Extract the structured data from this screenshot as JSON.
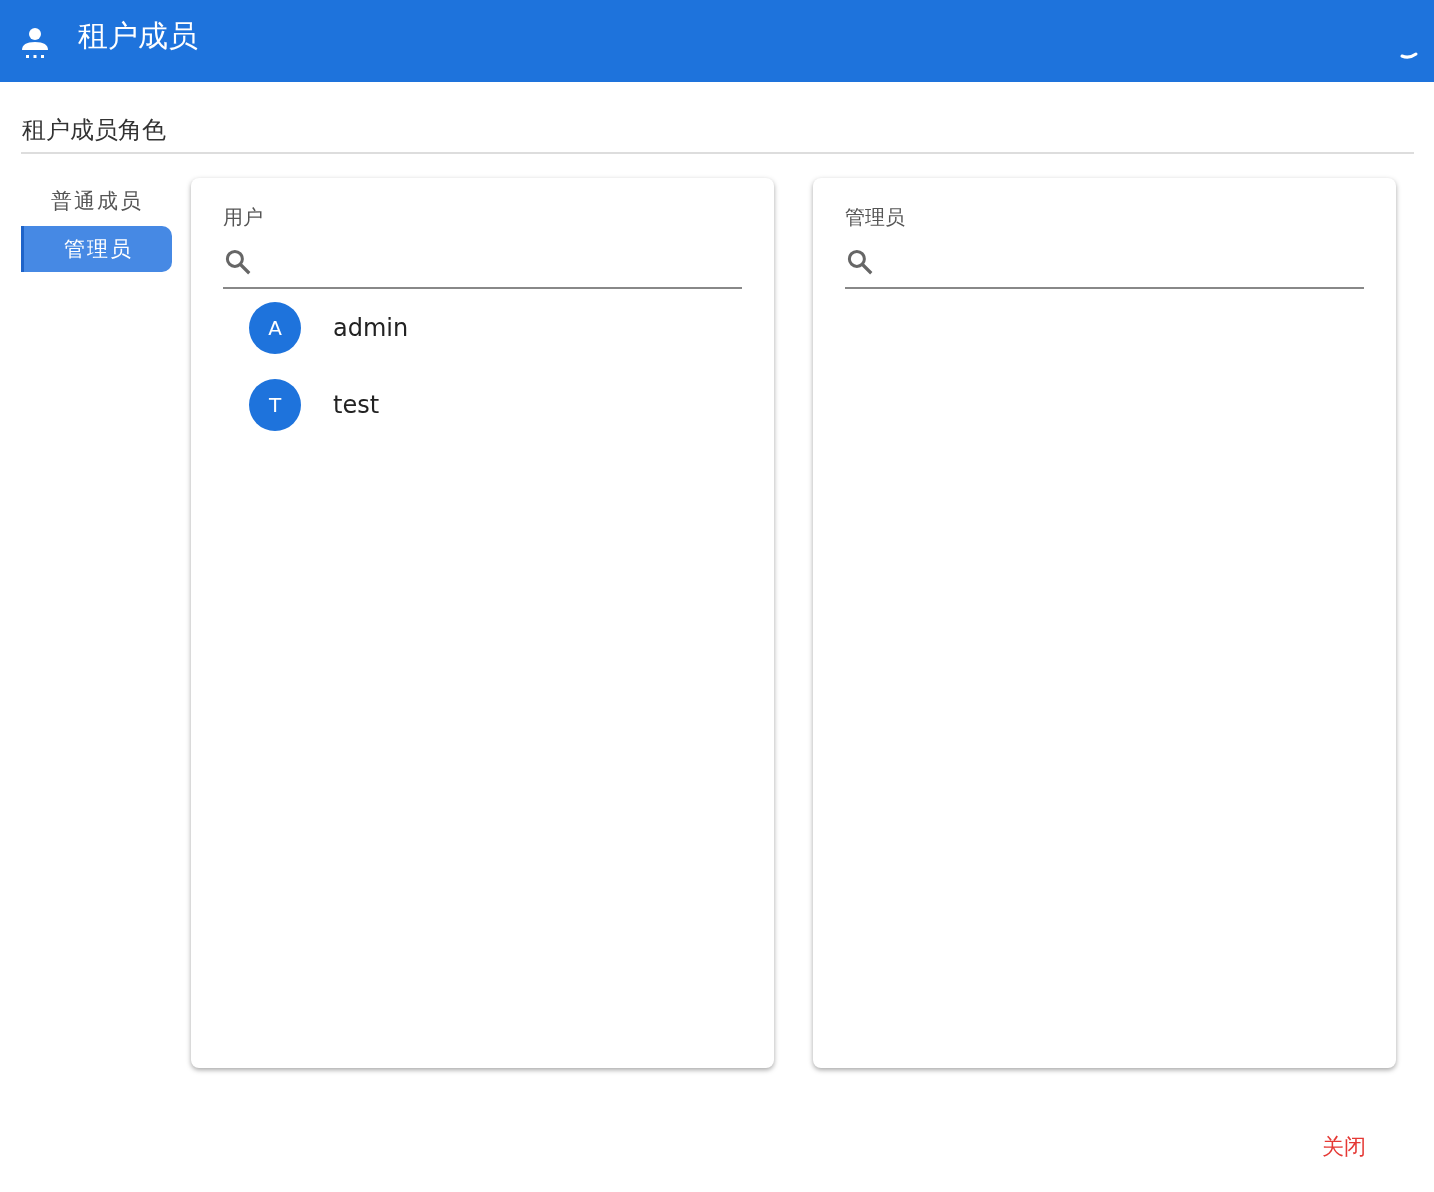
{
  "header": {
    "title": "租户成员"
  },
  "section": {
    "title": "租户成员角色"
  },
  "roles": [
    {
      "label": "普通成员",
      "selected": false
    },
    {
      "label": "管理员",
      "selected": true
    }
  ],
  "panels": [
    {
      "title": "用户",
      "users": [
        {
          "initial": "A",
          "name": "admin"
        },
        {
          "initial": "T",
          "name": "test"
        }
      ]
    },
    {
      "title": "管理员"
    }
  ],
  "close_button": {
    "label": "关闭"
  }
}
